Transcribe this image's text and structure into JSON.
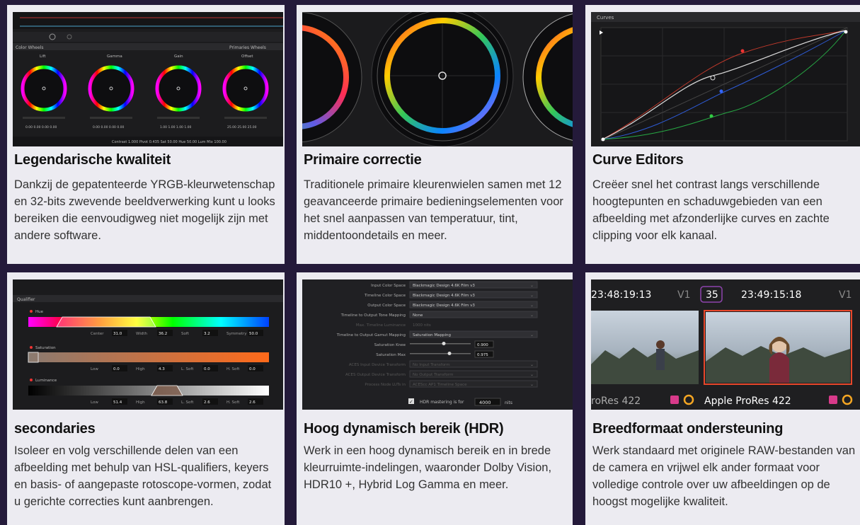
{
  "cards": [
    {
      "title": "Legendarische kwaliteit",
      "body": "Dankzij de gepatenteerde YRGB-kleurwetenschap en 32-bits zwevende beeldverwerking kunt u looks bereiken die eenvoudigweg niet mogelijk zijn met andere software.",
      "thumb": {
        "panel_left": "Color Wheels",
        "panel_right": "Primaries Wheels",
        "wheels": [
          "Lift",
          "Gamma",
          "Gain",
          "Offset"
        ],
        "values": [
          "0.00 0.00 0.00 0.00",
          "0.00 0.00 0.00 0.00",
          "1.00 1.00 1.00 1.00",
          "25.00 25.00 25.00"
        ],
        "footer": "Contrast 1.000   Pivot 0.435   Sat 50.00   Hue 50.00   Lum Mix 100.00"
      }
    },
    {
      "title": "Primaire correctie",
      "body": "Traditionele primaire kleurenwielen samen met 12 geavanceerde primaire bedieningselementen voor het snel aanpassen van temperatuur, tint, middentoondetails en meer."
    },
    {
      "title": "Curve Editors",
      "body": "Creëer snel het contrast langs verschillende hoogtepunten en schaduwgebieden van een afbeelding met afzonderlijke curves en zachte clipping voor elk kanaal.",
      "thumb": {
        "label": "Curves"
      }
    },
    {
      "title": "secondaries",
      "body": "Isoleer en volg verschillende delen van een afbeelding met behulp van HSL-qualifiers, keyers en basis- of aangepaste rotoscope-vormen, zodat u gerichte correcties kunt aanbrengen.",
      "thumb": {
        "header": "Qualifier",
        "hue": {
          "label": "Hue",
          "fields": [
            "Center",
            "31.0",
            "Width",
            "36.2",
            "Soft",
            "3.2",
            "Symmetry",
            "50.0"
          ]
        },
        "sat": {
          "label": "Saturation",
          "fields": [
            "Low",
            "0.0",
            "High",
            "4.3",
            "L. Soft",
            "0.0",
            "H. Soft",
            "0.0"
          ]
        },
        "lum": {
          "label": "Luminance",
          "fields": [
            "Low",
            "51.4",
            "High",
            "63.8",
            "L. Soft",
            "2.6",
            "H. Soft",
            "2.6"
          ]
        }
      }
    },
    {
      "title": "Hoog dynamisch bereik (HDR)",
      "body": "Werk in een hoog dynamisch bereik en in brede kleurruimte-indelingen, waaronder Dolby Vision, HDR10 +, Hybrid Log Gamma en meer.",
      "thumb": {
        "rows": [
          {
            "label": "Input Color Space",
            "value": "Blackmagic Design 4.6K Film v3"
          },
          {
            "label": "Timeline Color Space",
            "value": "Blackmagic Design 4.6K Film v3"
          },
          {
            "label": "Output Color Space",
            "value": "Blackmagic Design 4.6K Film v3"
          },
          {
            "label": "Timeline to Output Tone Mapping",
            "value": "None"
          },
          {
            "label": "Max. Timeline Luminance",
            "value": "1000   nits"
          },
          {
            "label": "Timeline to Output Gamut Mapping",
            "value": "Saturation Mapping"
          },
          {
            "label": "Saturation Knee",
            "value": "0.900"
          },
          {
            "label": "Saturation Max",
            "value": "0.975"
          },
          {
            "label": "ACES Input Device Transform",
            "value": "No Input Transform"
          },
          {
            "label": "ACES Output Device Transform",
            "value": "No Output Transform"
          },
          {
            "label": "Process Node LUTs in",
            "value": "ACEScc AP1 Timeline Space"
          }
        ],
        "hdr_label": "HDR mastering is for",
        "hdr_value": "4000",
        "hdr_unit": "nits"
      }
    },
    {
      "title": "Breedformaat ondersteuning",
      "body": "Werk standaard met originele RAW-bestanden van de camera en vrijwel elk ander formaat voor volledige controle over uw afbeeldingen op de hoogst mogelijke kwaliteit.",
      "thumb": {
        "tc_left": "23:48:19:13",
        "track_left": "V1",
        "clip_number": "35",
        "tc_right": "23:49:15:18",
        "track_right": "V1",
        "codec_left": "roRes 422",
        "codec_right": "Apple ProRes 422"
      }
    }
  ]
}
